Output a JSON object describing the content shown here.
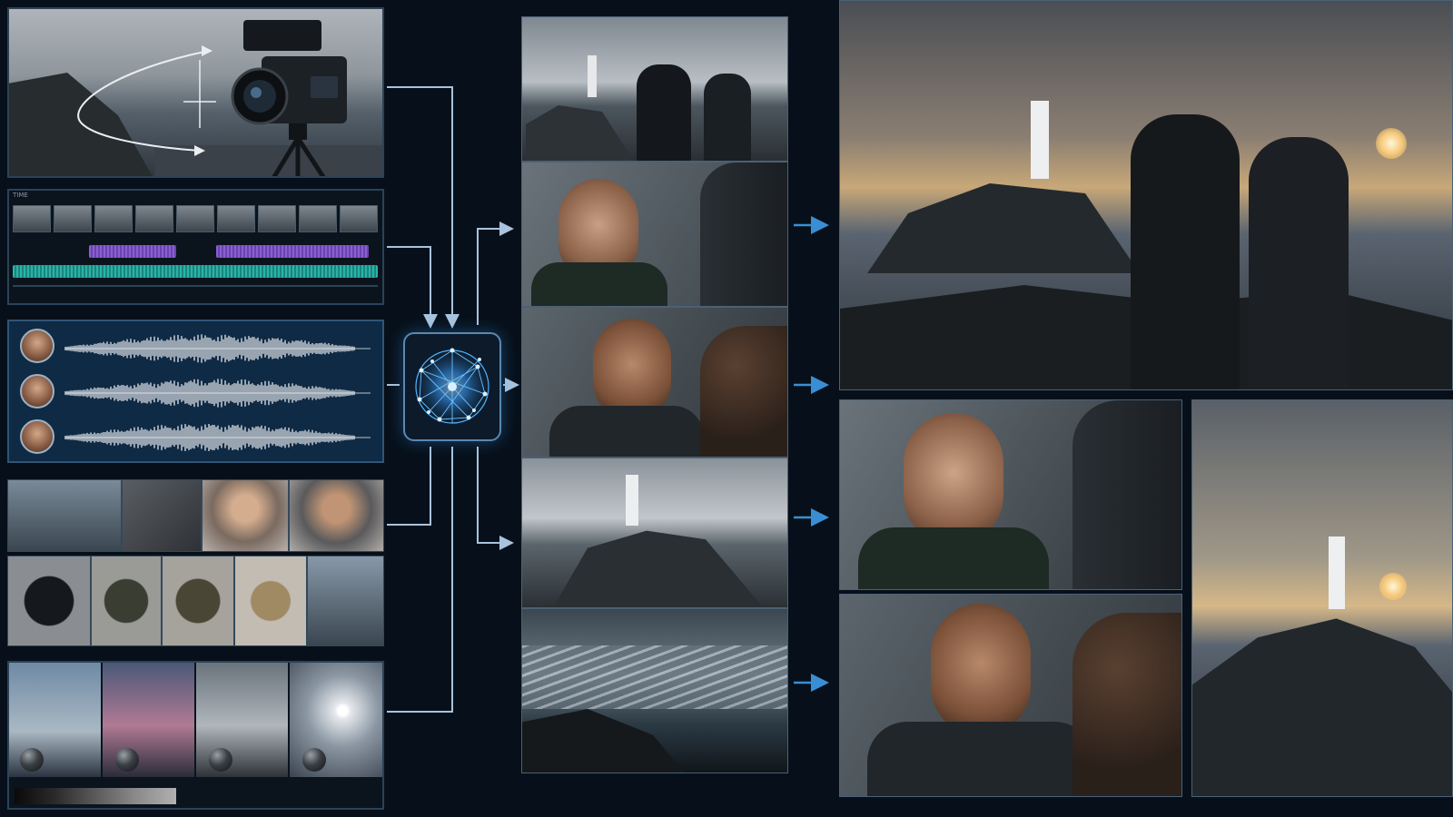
{
  "diagram": {
    "inputs": [
      {
        "id": "camera-motion",
        "icon": "camera-icon"
      },
      {
        "id": "edit-timeline",
        "icon": "timeline-icon",
        "ruler_label": "TIME"
      },
      {
        "id": "voice-tracks",
        "icon": "waveform-icon",
        "speakers": 3
      },
      {
        "id": "reference-assets",
        "items": [
          "coastline",
          "rock-texture",
          "woman",
          "man",
          "jacket",
          "backpack",
          "bag",
          "rope",
          "lighthouse"
        ]
      },
      {
        "id": "lighting-references",
        "items": [
          "overcast",
          "dusk",
          "cloudy",
          "sun"
        ]
      }
    ],
    "core": {
      "id": "ai-core",
      "icon": "neural-network-icon"
    },
    "stills": [
      "lighthouse-two-figures",
      "woman-closeup",
      "man-closeup",
      "lighthouse-cliff",
      "stormy-waves"
    ],
    "outputs": [
      "wide-lighthouse-sunset",
      "woman-closeup-final",
      "man-closeup-final",
      "lighthouse-sunset-portrait"
    ]
  },
  "colors": {
    "background": "#07101a",
    "connector": "#a9c3de",
    "arrow_accent": "#3a8fd4",
    "core_glow": "#3aa0ff",
    "waveform_purple": "#8a5fd0",
    "waveform_teal": "#2ab3a8"
  }
}
